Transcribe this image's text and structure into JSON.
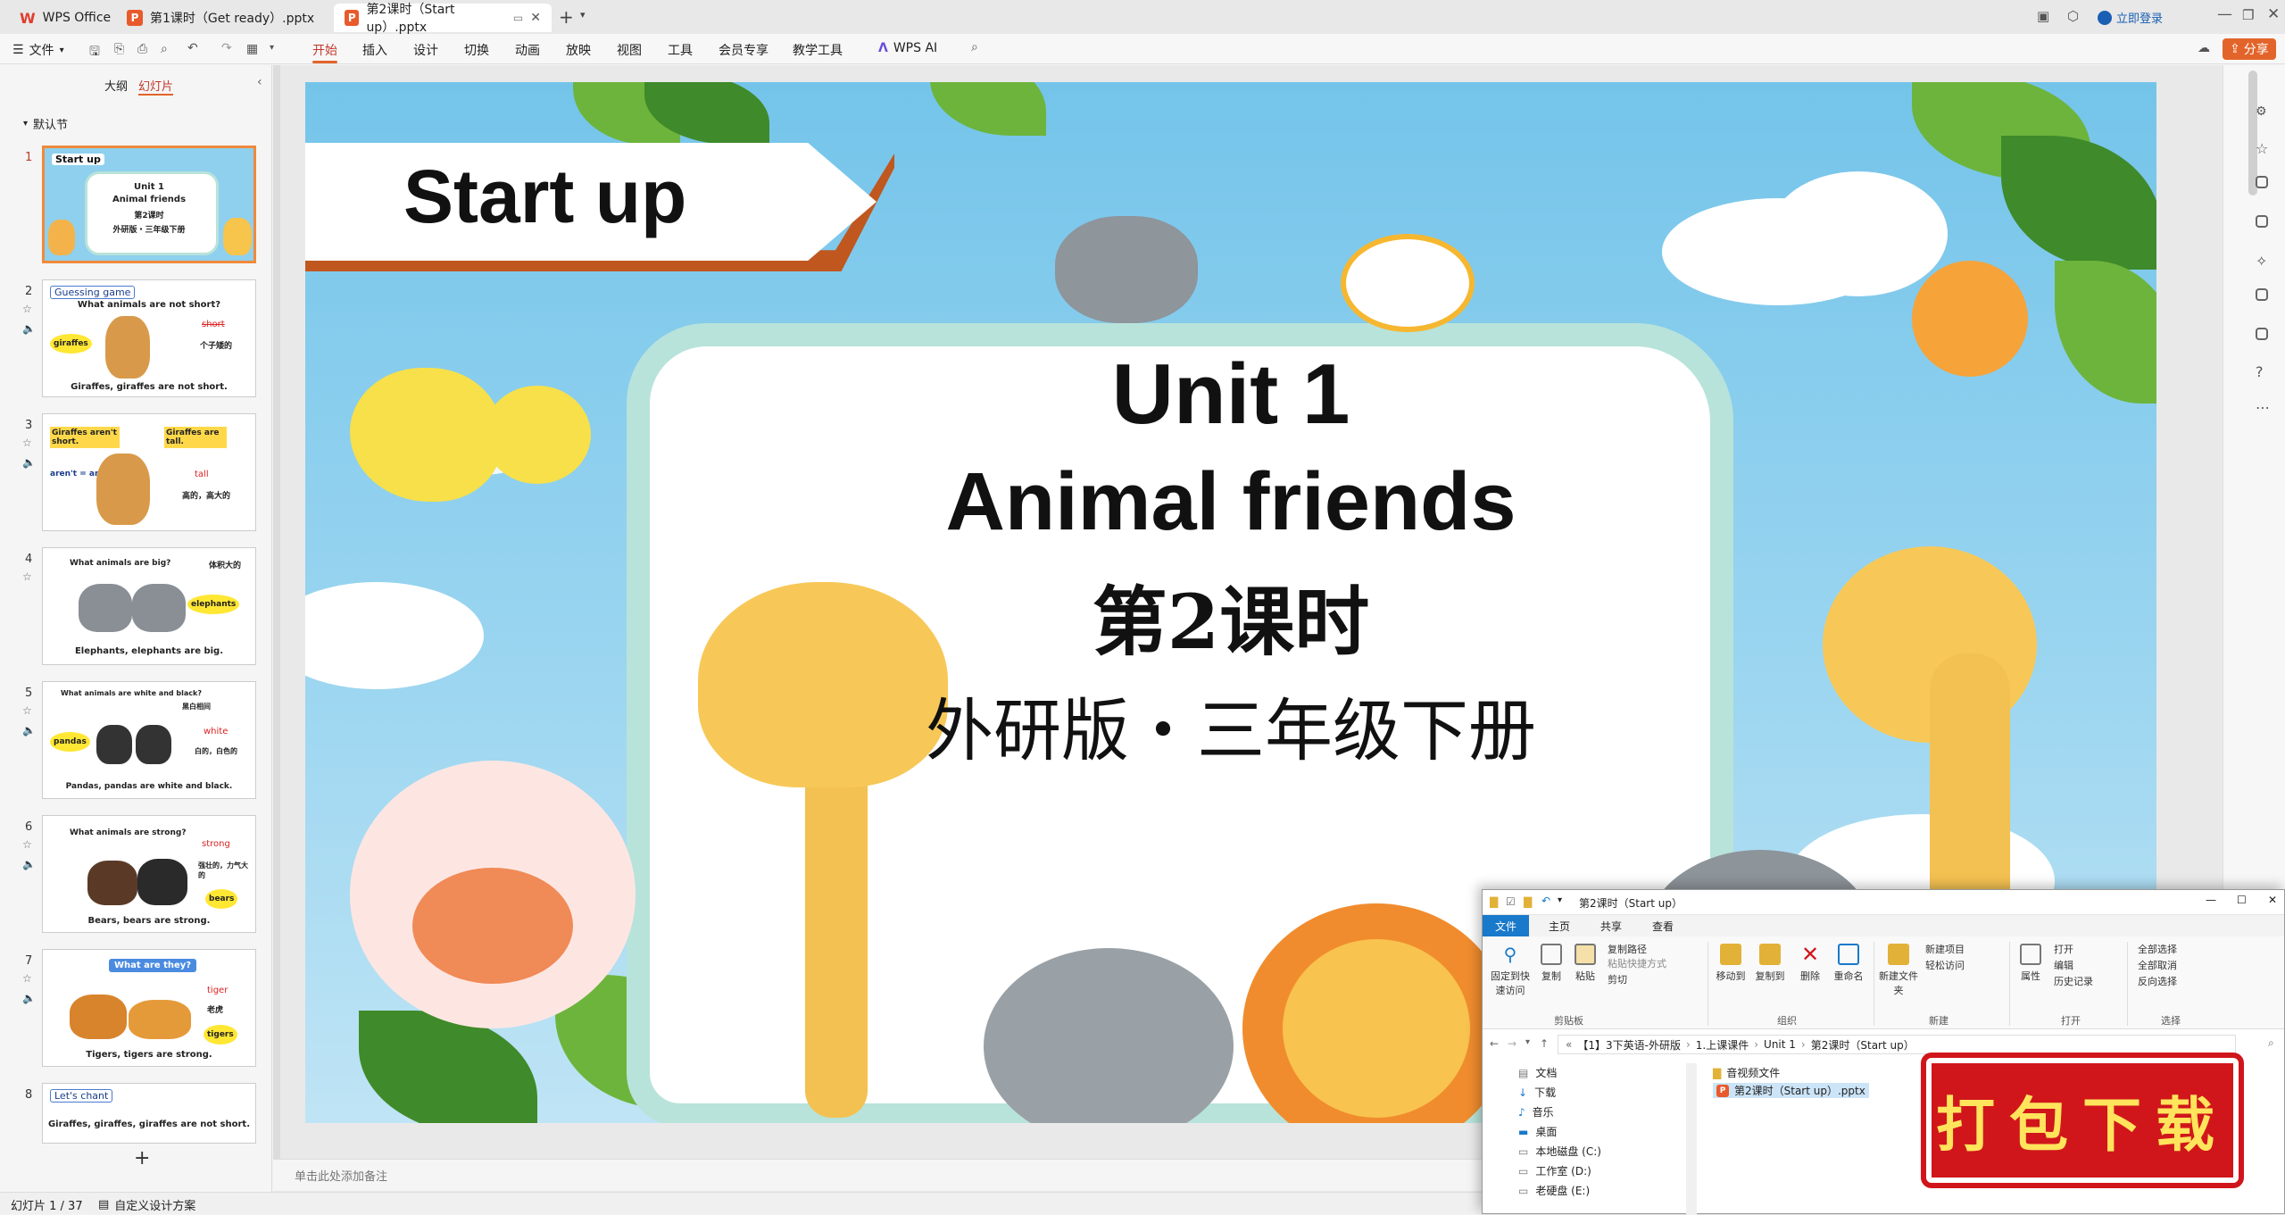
{
  "titlebar": {
    "app_name": "WPS Office",
    "tabs": [
      {
        "label": "第1课时（Get ready）.pptx"
      },
      {
        "label": "第2课时（Start up）.pptx"
      }
    ],
    "login_label": "立即登录"
  },
  "menubar": {
    "file_label": "文件",
    "items": [
      "开始",
      "插入",
      "设计",
      "切换",
      "动画",
      "放映",
      "视图",
      "工具",
      "会员专享",
      "教学工具"
    ],
    "ai_label": "WPS AI",
    "share_label": "分享"
  },
  "leftpanel": {
    "tab_outline": "大纲",
    "tab_slides": "幻灯片",
    "section_label": "默认节",
    "slides": [
      {
        "num": "1",
        "title": "Start up",
        "lines": [
          "Unit 1",
          "Animal friends",
          "第2课时",
          "外研版・三年级下册"
        ]
      },
      {
        "num": "2",
        "title": "Guessing game",
        "lines": [
          "What animals are not short?",
          "giraffes",
          "short",
          "个子矮的",
          "Giraffes, giraffes are not short."
        ]
      },
      {
        "num": "3",
        "title": "",
        "lines": [
          "Giraffes aren't short.",
          "Giraffes are tall.",
          "aren't = are not",
          "tall",
          "高的，高大的"
        ]
      },
      {
        "num": "4",
        "title": "",
        "lines": [
          "What animals are big?",
          "体积大的",
          "elephants",
          "Elephants, elephants are big."
        ]
      },
      {
        "num": "5",
        "title": "",
        "lines": [
          "What animals are white and black?",
          "黑白相间",
          "pandas",
          "white",
          "白的，白色的",
          "Pandas, pandas are white and black."
        ]
      },
      {
        "num": "6",
        "title": "",
        "lines": [
          "What animals are strong?",
          "strong",
          "强壮的，力气大的",
          "bears",
          "Bears, bears are strong."
        ]
      },
      {
        "num": "7",
        "title": "",
        "lines": [
          "What are they?",
          "tiger",
          "老虎",
          "tigers",
          "Tigers, tigers are strong."
        ]
      },
      {
        "num": "8",
        "title": "Let's chant",
        "lines": [
          "Giraffes, giraffes, giraffes are not short."
        ]
      }
    ],
    "add_label": "+"
  },
  "slide": {
    "banner": "Start up",
    "unit": "Unit 1",
    "topic": "Animal friends",
    "lesson": "第2课时",
    "edition": "外研版・三年级下册"
  },
  "notes_placeholder": "单击此处添加备注",
  "statusbar": {
    "slide_counter": "幻灯片 1 / 37",
    "design_label": "自定义设计方案"
  },
  "explorer": {
    "title": "第2课时（Start up）",
    "tabs": [
      "文件",
      "主页",
      "共享",
      "查看"
    ],
    "ribbon": {
      "clipboard": [
        "固定到快速访问",
        "复制",
        "粘贴",
        "复制路径",
        "粘贴快捷方式",
        "剪切"
      ],
      "organize": [
        "移动到",
        "复制到",
        "删除",
        "重命名"
      ],
      "new": [
        "新建文件夹",
        "新建项目",
        "轻松访问"
      ],
      "open": [
        "属性",
        "打开",
        "编辑",
        "历史记录"
      ],
      "select": [
        "全部选择",
        "全部取消",
        "反向选择"
      ],
      "group_labels": [
        "剪贴板",
        "组织",
        "新建",
        "打开",
        "选择"
      ]
    },
    "path": [
      "【1】3下英语-外研版",
      "1.上课课件",
      "Unit 1",
      "第2课时（Start up）"
    ],
    "nav": [
      "文档",
      "下载",
      "音乐",
      "桌面",
      "本地磁盘 (C:)",
      "工作室 (D:)",
      "老硬盘 (E:)"
    ],
    "files": [
      "音视频文件",
      "第2课时（Start up）.pptx"
    ]
  },
  "stamp_text": "打包下载",
  "colors": {
    "accent": "#e3642a",
    "banner_shadow": "#c0571f",
    "sky": "#74c4ea",
    "frame": "#b8e3da",
    "stamp": "#d0161b"
  }
}
